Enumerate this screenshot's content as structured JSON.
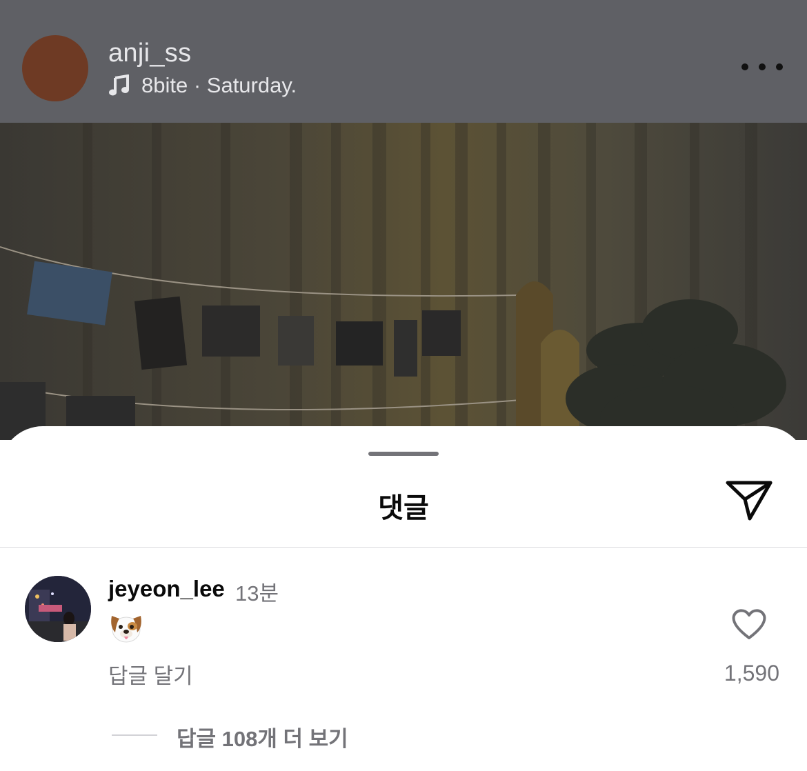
{
  "post": {
    "username": "anji_ss",
    "music": "8bite · Saturday.",
    "more_icon": "more-horizontal-icon"
  },
  "sheet": {
    "title": "댓글",
    "share_icon": "send-icon"
  },
  "comment": {
    "username": "jeyeon_lee",
    "time": "13분",
    "content_icon": "dog-face-emoji",
    "reply_label": "답글 달기",
    "like_count": "1,590",
    "like_icon": "heart-outline-icon",
    "view_replies": "답글 108개 더 보기"
  }
}
